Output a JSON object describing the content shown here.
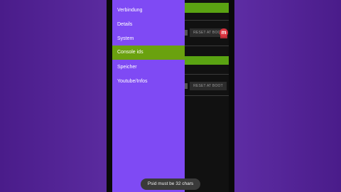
{
  "drawer": {
    "items": [
      {
        "label": "Verbindung",
        "active": false
      },
      {
        "label": "Details",
        "active": false
      },
      {
        "label": "System",
        "active": false
      },
      {
        "label": "Console ids",
        "active": true
      },
      {
        "label": "Speicher",
        "active": false
      },
      {
        "label": "Youtube/Infos",
        "active": false
      }
    ]
  },
  "content": {
    "reset_button_label": "RESET AT BOOT"
  },
  "toast": {
    "message": "Psid must be 32 chars"
  },
  "colors": {
    "drawer_bg": "#7f4af4",
    "active_item": "#6aa10f",
    "background": "#5d2ca3"
  }
}
